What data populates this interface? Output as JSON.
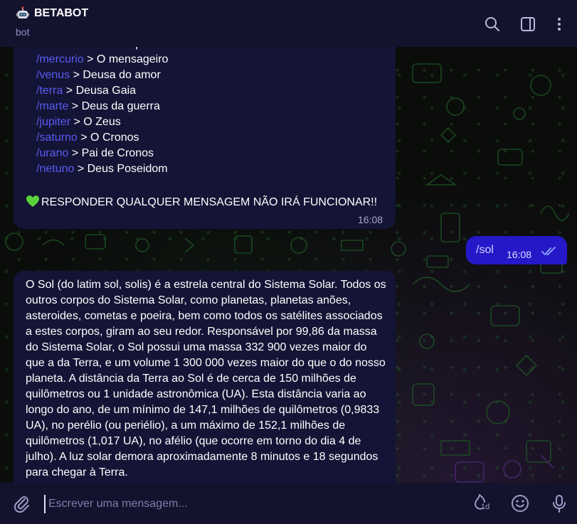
{
  "header": {
    "title": "BETABOT",
    "subtitle": "bot",
    "icons": [
      "robot-emoji",
      "search-icon",
      "sidebar-toggle-icon",
      "more-vert-icon"
    ]
  },
  "messages": {
    "bot_menu": {
      "commands": [
        {
          "cmd": "/sol",
          "desc": " > A estrela do tipo G"
        },
        {
          "cmd": "/mercurio",
          "desc": " > O mensageiro"
        },
        {
          "cmd": "/venus",
          "desc": " > Deusa do amor"
        },
        {
          "cmd": "/terra",
          "desc": " > Deusa Gaia"
        },
        {
          "cmd": "/marte",
          "desc": " > Deus da guerra"
        },
        {
          "cmd": "/jupiter",
          "desc": " > O Zeus"
        },
        {
          "cmd": "/saturno",
          "desc": " > O Cronos"
        },
        {
          "cmd": "/urano",
          "desc": " > Pai de Cronos"
        },
        {
          "cmd": "/netuno",
          "desc": " > Deus Poseidom"
        }
      ],
      "warning": "RESPONDER QUALQUER MENSAGEM NÃO IRÁ FUNCIONAR!!",
      "time": "16:08"
    },
    "user_msg": {
      "text": "/sol",
      "time": "16:08"
    },
    "bot_reply": {
      "text": "O Sol (do latim sol, solis) é a estrela central do Sistema Solar. Todos os outros corpos do Sistema Solar, como planetas, planetas anões, asteroides, cometas e poeira, bem como todos os satélites associados a estes corpos, giram ao seu redor. Responsável por 99,86 da massa do Sistema Solar, o Sol possui uma massa 332 900 vezes maior do que a da Terra, e um volume 1 300 000 vezes maior do que o do nosso planeta. A distância da Terra ao Sol é de cerca de 150 milhões de quilômetros ou 1 unidade astronômica (UA). Esta distância varia ao longo do ano, de um mínimo de 147,1 milhões de quilômetros (0,9833 UA), no perélio (ou periélio), a um máximo de 152,1 milhões de quilômetros (1,017 UA), no afélio (que ocorre em torno do dia 4 de julho). A luz solar demora aproximadamente 8 minutos e 18 segundos para chegar à Terra."
    }
  },
  "composer": {
    "placeholder": "Escrever uma mensagem...",
    "timer_label": "1d",
    "icons": [
      "attach-icon",
      "timer-icon",
      "emoji-icon",
      "microphone-icon"
    ]
  },
  "colors": {
    "header_bg": "#14132e",
    "bubble_in": "#141436",
    "bubble_out": "#2418c9",
    "command_link": "#5a5bf3"
  }
}
